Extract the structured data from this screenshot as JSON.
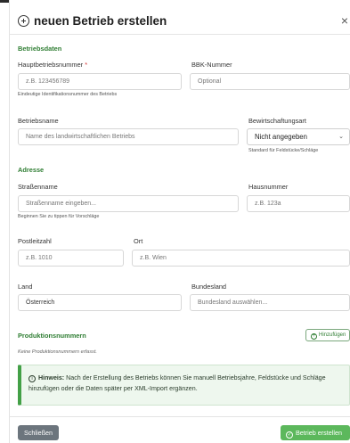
{
  "dialog": {
    "title": "neuen Betrieb erstellen",
    "close_glyph": "×"
  },
  "sections": {
    "betriebsdaten": "Betriebsdaten",
    "adresse": "Adresse",
    "produktionsnummern": "Produktionsnummern"
  },
  "fields": {
    "hauptbetriebsnummer": {
      "label": "Hauptbetriebsnummer",
      "required_mark": "*",
      "placeholder": "z.B. 123456789",
      "help": "Eindeutige Identifikationsnummer des Betriebs"
    },
    "bbk_nummer": {
      "label": "BBK-Nummer",
      "placeholder": "Optional"
    },
    "betriebsname": {
      "label": "Betriebsname",
      "placeholder": "Name des landwirtschaftlichen Betriebs"
    },
    "bewirtschaftungsart": {
      "label": "Bewirtschaftungsart",
      "selected": "Nicht angegeben",
      "help": "Standard für Feldstücke/Schläge"
    },
    "strassenname": {
      "label": "Straßenname",
      "placeholder": "Straßenname eingeben...",
      "help": "Beginnen Sie zu tippen für Vorschläge"
    },
    "hausnummer": {
      "label": "Hausnummer",
      "placeholder": "z.B. 123a"
    },
    "postleitzahl": {
      "label": "Postleitzahl",
      "placeholder": "z.B. 1010"
    },
    "ort": {
      "label": "Ort",
      "placeholder": "z.B. Wien"
    },
    "land": {
      "label": "Land",
      "value": "Österreich"
    },
    "bundesland": {
      "label": "Bundesland",
      "placeholder": "Bundesland auswählen..."
    }
  },
  "produktion": {
    "add_label": "Hinzufügen",
    "empty_text": "Keine Produktionsnummern erfasst."
  },
  "hint": {
    "icon": "i",
    "bold": "Hinweis:",
    "text": "Nach der Erstellung des Betriebs können Sie manuell Betriebsjahre, Feldstücke und Schläge hinzufügen oder die Daten später per XML-Import ergänzen."
  },
  "footer": {
    "close_label": "Schließen",
    "create_label": "Betrieb erstellen"
  },
  "colors": {
    "accent_green": "#2e7d32",
    "create_button": "#5cb85c",
    "close_button": "#6c757d",
    "required": "#d32f2f"
  }
}
